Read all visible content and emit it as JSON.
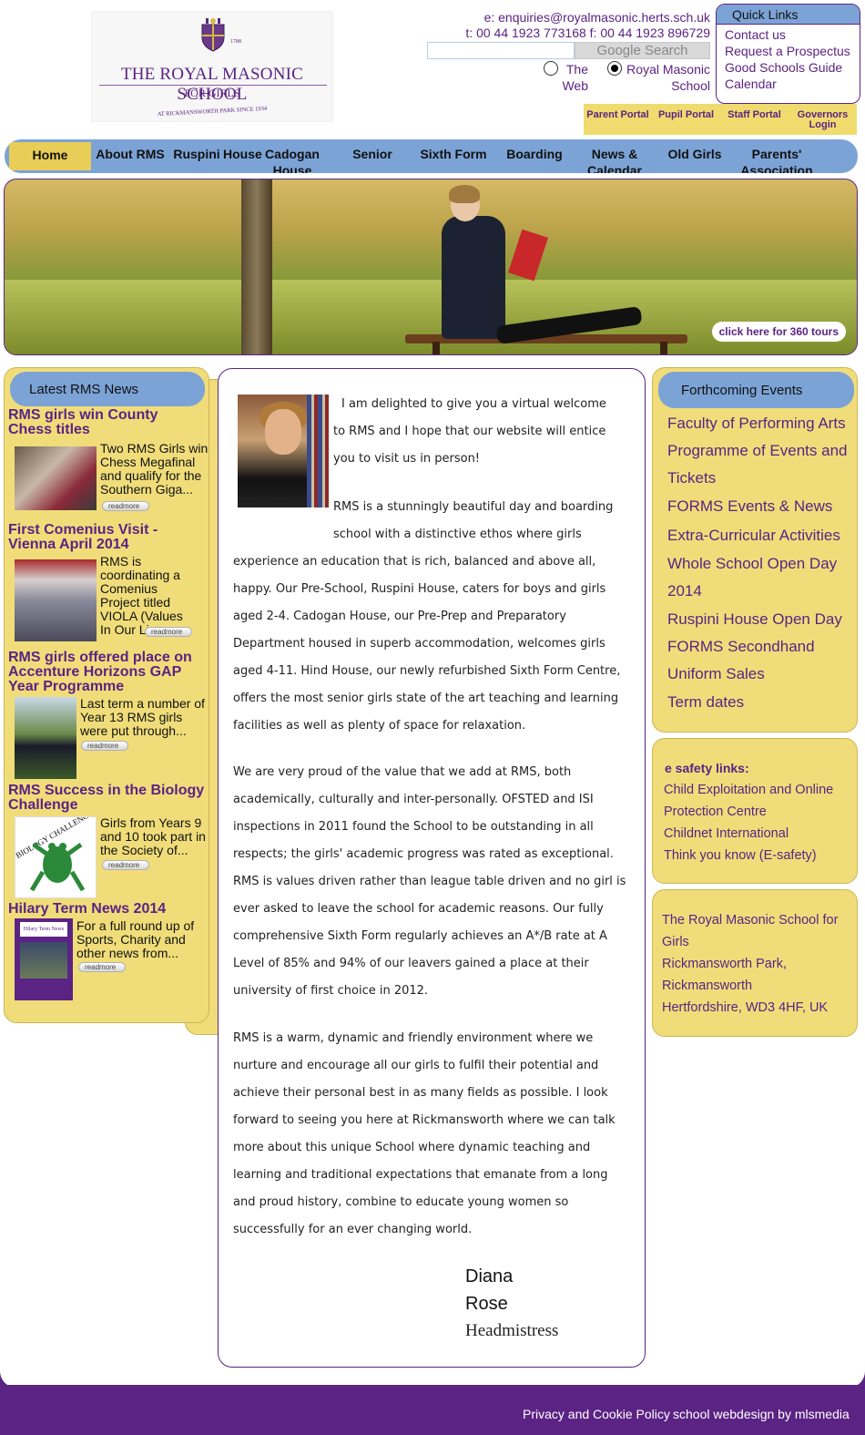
{
  "header": {
    "logo": {
      "est_left": "Est.",
      "est_right": "1788",
      "title": "THE ROYAL MASONIC SCHOOL",
      "subtitle": "FOR GIRLS",
      "tagline": "AT RICKMANSWORTH PARK SINCE 1934"
    },
    "email": "e: enquiries@royalmasonic.herts.sch.uk",
    "phone": "t: 00 44 1923 773168  f: 00 44 1923 896729",
    "search": {
      "placeholder": "",
      "button": "Google Search"
    },
    "radio": {
      "option1": "The Web",
      "option2": "Royal Masonic School",
      "selected": "option2"
    }
  },
  "quick_links": {
    "title": "Quick Links",
    "items": [
      "Contact us",
      "Request a Prospectus",
      "Good Schools Guide",
      "Calendar"
    ]
  },
  "portals": [
    "Parent Portal",
    "Pupil Portal",
    "Staff Portal",
    "Governors Login"
  ],
  "nav": [
    "Home",
    "About RMS",
    "Ruspini",
    "House",
    "Cadogan House",
    "Senior",
    "Sixth Form",
    "Boarding",
    "News & Calendar",
    "Old Girls",
    "Parents' Association"
  ],
  "hero": {
    "tour_button": "click here for 360 tours"
  },
  "news": {
    "title": "Latest RMS News",
    "readmore": "readmore",
    "items": [
      {
        "title": "RMS girls win County Chess titles",
        "text": "Two RMS Girls win Chess Megafinal and qualify for the Southern Giga..."
      },
      {
        "title": "First Comenius Visit - Vienna April 2014",
        "text": "RMS is coordinating a Comenius Project titled VIOLA (Values In Our Lives..."
      },
      {
        "title": "RMS girls offered place on Accenture Horizons GAP Year Programme",
        "text": "Last term a number of Year 13 RMS girls were put through..."
      },
      {
        "title": "RMS Success in the Biology Challenge",
        "text": "Girls from Years 9 and 10 took part in the Society of..."
      },
      {
        "title": "Hilary Term News 2014",
        "text": "For a full round up of Sports, Charity and other news from..."
      }
    ],
    "thumb_labels": {
      "biology": "BIOLOGY CHALLENGE",
      "hilary": "Hilary Term News"
    }
  },
  "welcome": {
    "p1_a": "I am delighted to give you a virtual welcome",
    "p1_b": "to RMS and I hope that our website will entice",
    "p1_c": "you to visit us in person!",
    "p2_a": "RMS is a stunningly beautiful day and boarding",
    "p2_b": "school with a distinctive ethos where girls",
    "p2_rest": "experience an education that is rich, balanced and above all, happy. Our Pre-School, Ruspini House, caters for boys and girls aged 2-4. Cadogan House, our Pre-Prep and Preparatory Department housed in superb accommodation, welcomes girls aged 4-11. Hind House, our newly refurbished Sixth Form Centre, offers the most senior girls state of the art teaching and learning facilities as well as plenty of space for relaxation.",
    "p3": "We are very proud of the value that we add at RMS, both academically, culturally and inter-personally. OFSTED and ISI inspections in 2011 found the School to be outstanding in all respects; the girls' academic progress was rated as exceptional. RMS is values driven rather than league table driven and no girl is ever asked to leave the school for academic reasons. Our fully comprehensive Sixth Form regularly achieves an A*/B rate at A Level of 85% and 94% of our leavers gained a place at their university of first choice in 2012.",
    "p4": "RMS is a warm, dynamic and friendly environment where we nurture and encourage all our girls to fulfil their potential and achieve their personal best in as many fields as possible. I look forward to seeing you here at Rickmansworth where we can talk more about this unique School where dynamic teaching and learning and traditional expectations that emanate from a long and proud history, combine to educate young women so successfully for an ever changing world.",
    "sig_first": "Diana",
    "sig_last": "Rose",
    "sig_role": "Headmistress"
  },
  "events": {
    "title": "Forthcoming Events",
    "items": [
      "Faculty of Performing Arts",
      "Programme of Events and",
      "Tickets",
      "FORMS Events & News",
      "Extra-Curricular Activities",
      "Whole School Open Day",
      "2014",
      "Ruspini House Open Day",
      "FORMS Secondhand",
      "Uniform Sales",
      "Term dates"
    ]
  },
  "safety": {
    "title": "e safety links:",
    "items": [
      "Child Exploitation and Online",
      "Protection Centre",
      "Childnet International",
      "Think you know (E-safety)"
    ]
  },
  "address": {
    "lines": [
      "The Royal Masonic School for",
      "Girls",
      "Rickmansworth Park,",
      "Rickmansworth",
      "Hertfordshire, WD3 4HF, UK"
    ]
  },
  "footer": {
    "privacy": "Privacy and Cookie Policy",
    "credit": "school webdesign by mlsmedia"
  },
  "colors": {
    "purple": "#5b2383",
    "blue": "#7ca3d6",
    "yellow": "#f0dd7a",
    "gold": "#e8cd56"
  }
}
